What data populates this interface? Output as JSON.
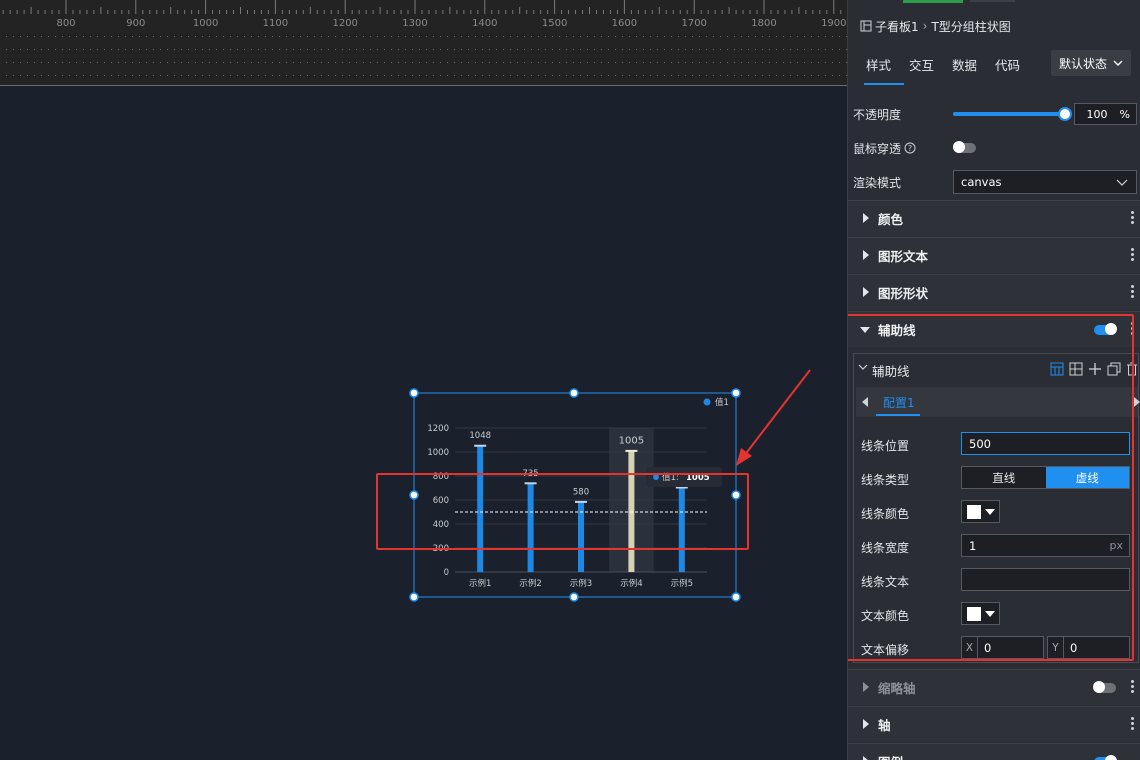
{
  "ruler": {
    "ticks": [
      "800",
      "900",
      "1000",
      "1100",
      "1200",
      "1300",
      "1400",
      "1500",
      "1600",
      "1700",
      "1800",
      "1900"
    ]
  },
  "chart_data": {
    "type": "bar",
    "categories": [
      "示例1",
      "示例2",
      "示例3",
      "示例4",
      "示例5"
    ],
    "series": [
      {
        "name": "值1",
        "values": [
          1048,
          735,
          580,
          1005,
          700
        ]
      }
    ],
    "data_labels": [
      "1048",
      "735",
      "580",
      "1005",
      ""
    ],
    "yticks": [
      "0",
      "200",
      "400",
      "600",
      "800",
      "1000",
      "1200"
    ],
    "ylim": [
      0,
      1200
    ],
    "reference_line": 500,
    "highlighted_category": "示例4",
    "tooltip": {
      "series": "值1:",
      "value": "1005"
    },
    "colors": {
      "bar": "#1e88e5",
      "highlight": "#d8d2b5",
      "line": "#ffffff"
    },
    "legend_position": "top-right"
  },
  "panel": {
    "crumb_root": "子看板1",
    "crumb_sep": "›",
    "crumb_current": "T型分组柱状图",
    "tabs": [
      "样式",
      "交互",
      "数据",
      "代码"
    ],
    "state": "默认状态",
    "opacity_label": "不透明度",
    "opacity_value": "100",
    "opacity_unit": "%",
    "passthrough_label": "鼠标穿透",
    "render_label": "渲染模式",
    "render_value": "canvas",
    "sections": {
      "color": "颜色",
      "shape_text": "图形文本",
      "shape": "图形形状",
      "guide": "辅助线",
      "thumb_axis": "缩略轴",
      "axis": "轴",
      "legend": "图例"
    },
    "guide_sub": {
      "title": "辅助线",
      "config_tab": "配置1",
      "line_position_label": "线条位置",
      "line_position_value": "500",
      "line_type_label": "线条类型",
      "line_type_solid": "直线",
      "line_type_dashed": "虚线",
      "line_color_label": "线条颜色",
      "line_width_label": "线条宽度",
      "line_width_value": "1",
      "line_width_unit": "px",
      "line_text_label": "线条文本",
      "line_text_value": "",
      "text_color_label": "文本颜色",
      "text_offset_label": "文本偏移",
      "offset_x_key": "X",
      "offset_x": "0",
      "offset_y_key": "Y",
      "offset_y": "0"
    }
  }
}
